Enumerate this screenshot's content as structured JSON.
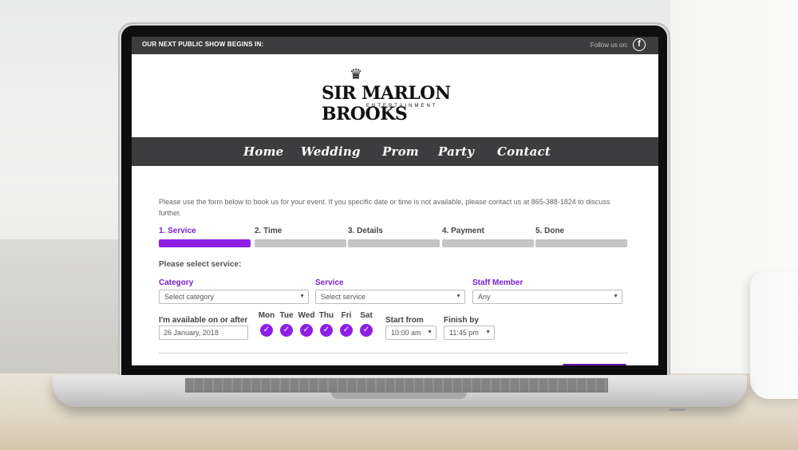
{
  "topbar": {
    "message": "OUR NEXT PUBLIC SHOW BEGINS IN:",
    "follow_text": "Follow us on:",
    "facebook_glyph": "f"
  },
  "logo": {
    "crown_glyph": "♛",
    "name": "SIR MARLON BROOKS",
    "sub": "ENTERTAINMENT"
  },
  "nav": {
    "items": [
      "Home",
      "Wedding",
      "Prom",
      "Party",
      "Contact"
    ]
  },
  "form": {
    "intro": "Please use the form below to book us for your event. If you specific date or time is not available, please contact us at 865-388-1824 to discuss further.",
    "steps": [
      "1. Service",
      "2. Time",
      "3. Details",
      "4. Payment",
      "5. Done"
    ],
    "active_step": 0,
    "select_title": "Please select service:",
    "category": {
      "label": "Category",
      "value": "Select category"
    },
    "service": {
      "label": "Service",
      "value": "Select service"
    },
    "staff": {
      "label": "Staff Member",
      "value": "Any"
    },
    "available_label": "I'm available on or after",
    "date_value": "26 January, 2018",
    "days": [
      "Mon",
      "Tue",
      "Wed",
      "Thu",
      "Fri",
      "Sat"
    ],
    "check_glyph": "✓",
    "caret_glyph": "▼",
    "start_from": {
      "label": "Start from",
      "value": "10:00 am"
    },
    "finish_by": {
      "label": "Finish by",
      "value": "11:45 pm"
    }
  },
  "colors": {
    "accent": "#8d1ee6",
    "bar_dark": "#3d3d3f"
  }
}
